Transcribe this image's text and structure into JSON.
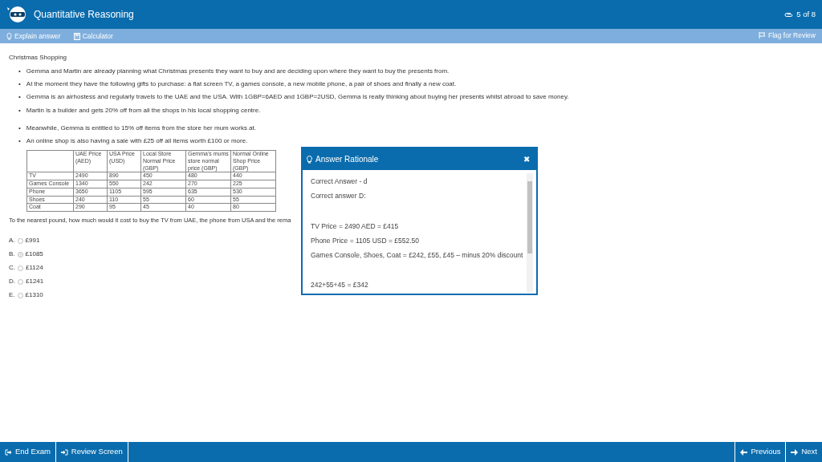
{
  "header": {
    "title": "Quantitative Reasoning",
    "progress": "5 of 8"
  },
  "toolbar": {
    "left": [
      {
        "kind": "bulb",
        "label": "Explain answer"
      },
      {
        "kind": "calc",
        "label": "Calculator"
      }
    ],
    "right": {
      "kind": "flag",
      "label": "Flag for Review"
    }
  },
  "passage": {
    "title": "Christmas Shopping",
    "bullets": [
      {
        "marker": "•",
        "text": "Gemma and Martin are already planning what Christmas presents they want to buy and are deciding upon where they want to buy the presents from."
      },
      {
        "marker": "•",
        "text": "At the moment they have the following gifts to purchase: a flat screen TV, a games console, a new mobile phone, a pair of shoes and finally a new coat."
      },
      {
        "marker": "•",
        "text": "Gemma is an airhostess and regularly travels to the UAE and the USA. With 1GBP=6AED and 1GBP=2USD, Gemma is really thinking about buying her presents whilst abroad to save money."
      },
      {
        "marker": "•",
        "text": "Martin is a builder and gets 20% off from all the shops in his local shopping centre."
      },
      {
        "marker": "•",
        "text": "Meanwhile, Gemma is entitled to 15% off items from the store her mum works at."
      },
      {
        "marker": "•",
        "text": "An online shop is also having a sale with £25 off all items worth £100 or more."
      }
    ]
  },
  "table": {
    "columns": [
      "UAE Price (AED)",
      "USA Price (USD)",
      "Local Store Normal Price (GBP)",
      "Gemma's mums store normal price (GBP)",
      "Normal Online Shop Price (GBP)"
    ],
    "rows": [
      {
        "item": "TV",
        "cells": [
          "2490",
          "890",
          "450",
          "480",
          "440"
        ]
      },
      {
        "item": "Games Console",
        "cells": [
          "1340",
          "550",
          "242",
          "270",
          "225"
        ]
      },
      {
        "item": "Phone",
        "cells": [
          "3650",
          "1105",
          "595",
          "635",
          "530"
        ]
      },
      {
        "item": "Shoes",
        "cells": [
          "240",
          "110",
          "55",
          "60",
          "55"
        ]
      },
      {
        "item": "Coat",
        "cells": [
          "290",
          "95",
          "45",
          "40",
          "80"
        ]
      }
    ]
  },
  "question": "To the nearest pound, how much would it cost to buy the TV from UAE, the phone from USA and the rema",
  "answers": [
    {
      "letter": "A.",
      "text": "£991",
      "selected": false
    },
    {
      "letter": "B.",
      "text": "£1085",
      "selected": true
    },
    {
      "letter": "C.",
      "text": "£1124",
      "selected": false
    },
    {
      "letter": "D.",
      "text": "£1241",
      "selected": false
    },
    {
      "letter": "E.",
      "text": "£1310",
      "selected": false
    }
  ],
  "dialog": {
    "title": "Answer Rationale",
    "close": "✖",
    "lines": [
      {
        "kind": "text",
        "text": "Correct Answer - d"
      },
      {
        "kind": "text",
        "text": "Correct answer D:"
      },
      {
        "kind": "gap"
      },
      {
        "kind": "text",
        "text": "TV Price = 2490 AED  = £415"
      },
      {
        "kind": "text",
        "text": "Phone Price = 1105 USD = £552.50"
      },
      {
        "kind": "text",
        "text": "Games Console, Shoes, Coat = £242, £55, £45 – minus 20% discount"
      },
      {
        "kind": "gap"
      },
      {
        "kind": "text",
        "text": "242+55+45 = £342"
      }
    ]
  },
  "footer": {
    "left": [
      {
        "kind": "exit",
        "label": "End Exam"
      },
      {
        "kind": "enter",
        "label": "Review Screen"
      }
    ],
    "right": [
      {
        "kind": "prev",
        "label": "Previous"
      },
      {
        "kind": "next",
        "label": "Next"
      }
    ]
  }
}
